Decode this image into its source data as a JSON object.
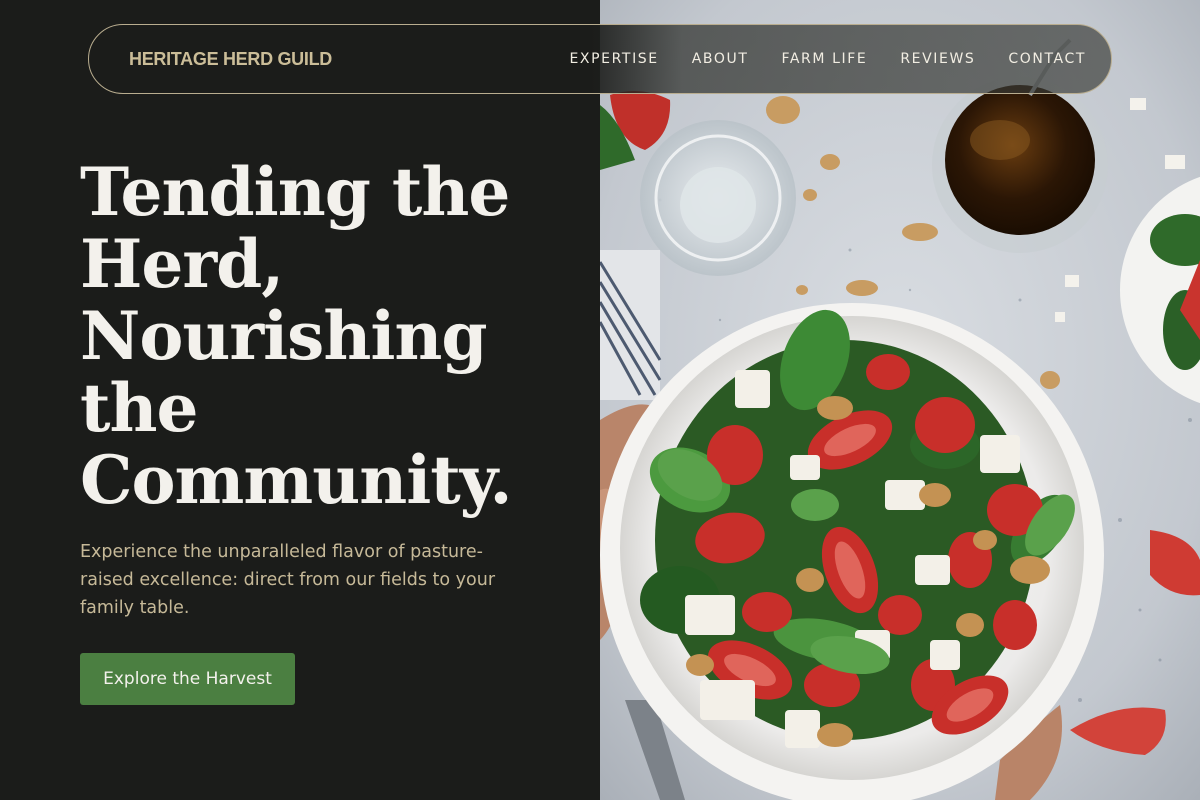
{
  "brand": {
    "name": "HERITAGE HERD GUILD"
  },
  "nav": {
    "items": [
      {
        "label": "EXPERTISE"
      },
      {
        "label": "ABOUT"
      },
      {
        "label": "FARM LIFE"
      },
      {
        "label": "REVIEWS"
      },
      {
        "label": "CONTACT"
      }
    ]
  },
  "hero": {
    "title": "Tending the Herd, Nourishing the Community.",
    "subtitle": "Experience the unparalleled flavor of pasture-raised excellence: direct from our fields to your family table.",
    "cta_label": "Explore the Harvest"
  },
  "colors": {
    "background": "#1b1c1a",
    "accent_gold": "#cbbd98",
    "cta_green": "#4b7f41",
    "headline": "#f3f1ec"
  },
  "icons": {
    "photo": "salad-bowl-photo"
  }
}
